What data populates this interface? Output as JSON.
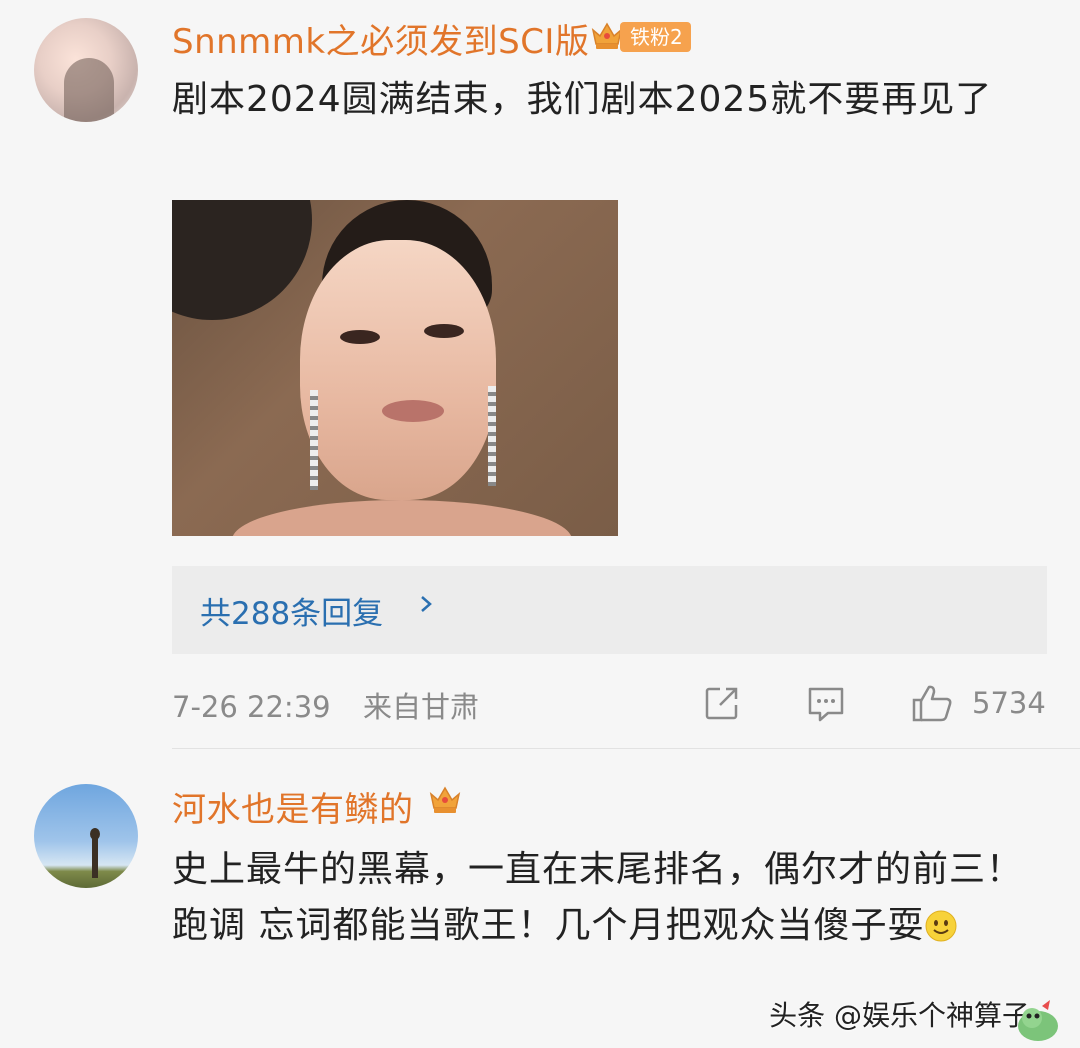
{
  "comments": [
    {
      "username": "Snnmmk之必须发到SCI版",
      "badge": "铁粉2",
      "text": "剧本2024圆满结束，我们剧本2025就不要再见了",
      "replies_label": "共288条回复",
      "time": "7-26 22:39",
      "location": "来自甘肃",
      "likes": "5734"
    },
    {
      "username": "河水也是有鳞的",
      "text": "史上最牛的黑幕，一直在末尾排名，偶尔才的前三！跑调 忘词都能当歌王！几个月把观众当傻子耍"
    }
  ],
  "watermark": "头条 @娱乐个神算子",
  "icons": [
    "crown-icon",
    "chevron-right-icon",
    "share-icon",
    "comment-icon",
    "like-icon",
    "smile-emoji-icon"
  ],
  "colors": {
    "username": "#e1752a",
    "link": "#2a6fb0",
    "meta": "#8a8a8a",
    "badge": "#f6a24e"
  }
}
